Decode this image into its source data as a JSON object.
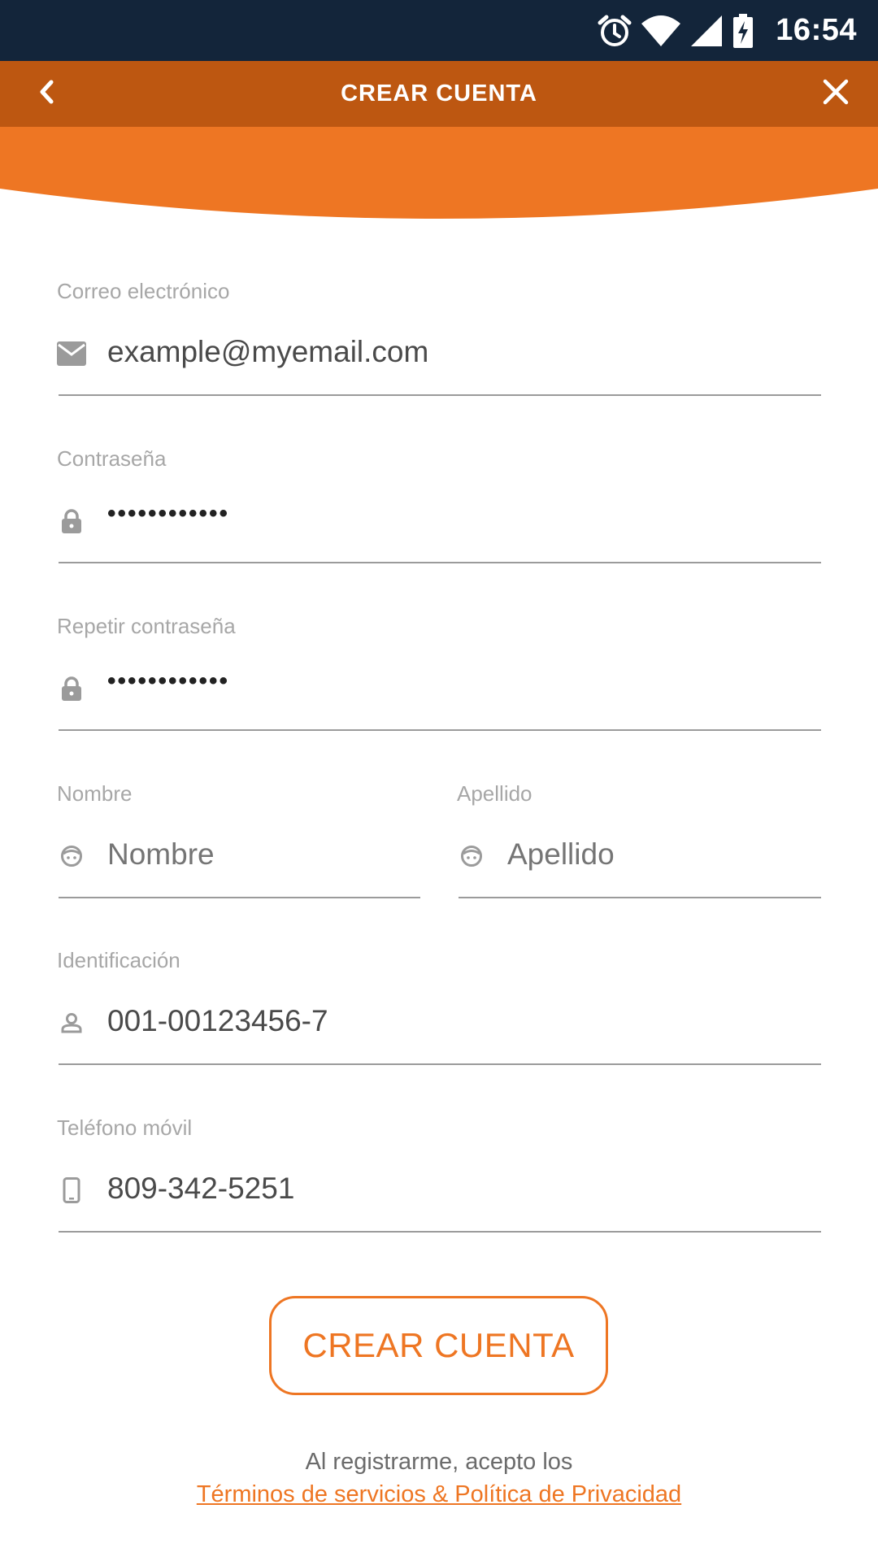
{
  "status_bar": {
    "time": "16:54",
    "icons": [
      "alarm-icon",
      "wifi-icon",
      "cell-signal-icon",
      "battery-charging-icon"
    ]
  },
  "toolbar": {
    "title": "CREAR CUENTA",
    "back_icon": "chevron-left-icon",
    "close_icon": "close-icon"
  },
  "colors": {
    "status_bar": "#13253a",
    "toolbar": "#bd5711",
    "accent": "#ee7623",
    "label": "#a7a7a7",
    "value": "#4a4a4a"
  },
  "form": {
    "email": {
      "label": "Correo electrónico",
      "value": "example@myemail.com",
      "icon": "mail-icon"
    },
    "password": {
      "label": "Contraseña",
      "value": "••••••••••••",
      "icon": "lock-icon"
    },
    "repeat_password": {
      "label": "Repetir contraseña",
      "value": "••••••••••••",
      "icon": "lock-icon"
    },
    "first_name": {
      "label": "Nombre",
      "placeholder": "Nombre",
      "icon": "face-icon"
    },
    "last_name": {
      "label": "Apellido",
      "placeholder": "Apellido",
      "icon": "face-icon"
    },
    "id_number": {
      "label": "Identificación",
      "value": "001-00123456-7",
      "icon": "person-icon"
    },
    "mobile": {
      "label": "Teléfono móvil",
      "value": "809-342-5251",
      "icon": "phone-icon"
    }
  },
  "submit_button": {
    "label": "CREAR CUENTA"
  },
  "footer": {
    "text": "Al registrarme, acepto los",
    "link": "Términos de servicios & Política de Privacidad"
  }
}
